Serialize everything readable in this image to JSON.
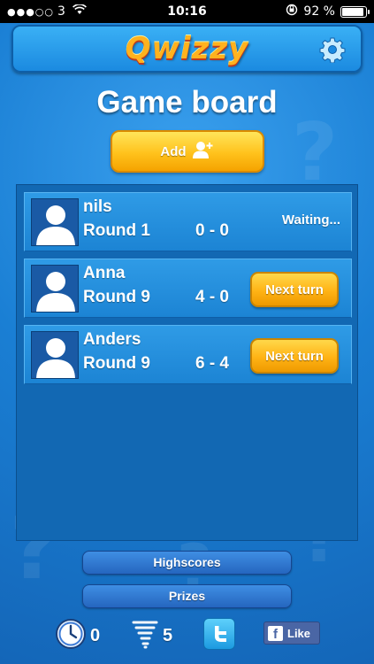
{
  "status_bar": {
    "signal": "●●●○○",
    "carrier": "3",
    "time": "10:16",
    "battery_label": "92 %",
    "battery_level": 0.92
  },
  "header": {
    "logo": "Qwizzy",
    "settings_icon": "gear-icon"
  },
  "page_title": "Game board",
  "add_button": {
    "label": "Add",
    "icon": "add-user-icon"
  },
  "games": [
    {
      "name": "nils",
      "round": "Round 1",
      "score": "0 - 0",
      "status": "Waiting...",
      "action": ""
    },
    {
      "name": "Anna",
      "round": "Round 9",
      "score": "4 - 0",
      "status": "",
      "action": "Next turn"
    },
    {
      "name": "Anders",
      "round": "Round 9",
      "score": "6 - 4",
      "status": "",
      "action": "Next turn"
    }
  ],
  "menu": {
    "highscores": "Highscores",
    "prizes": "Prizes"
  },
  "footer": {
    "timer_count": "0",
    "tornado_count": "5",
    "twitter_icon": "twitter-icon",
    "like_label": "Like"
  },
  "colors": {
    "background": "#1d82d6",
    "accent_yellow": "#ffc21c",
    "board": "#1268b3"
  }
}
